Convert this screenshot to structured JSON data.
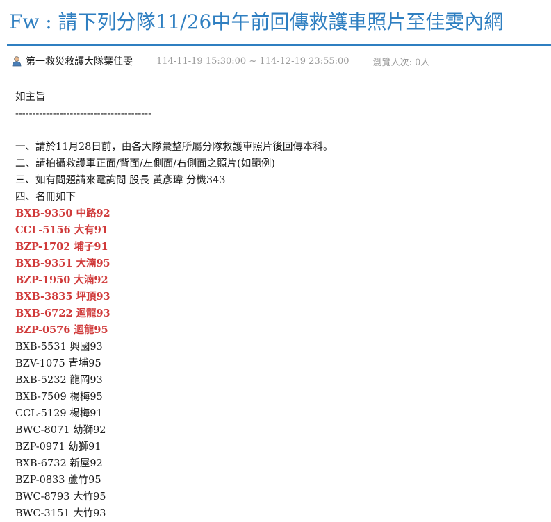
{
  "post": {
    "title": "Fw : 請下列分隊11/26中午前回傳救護車照片至佳雯內網",
    "author": "第一救災救護大隊葉佳雯",
    "period": "114-11-19 15:30:00 ~ 114-12-19 23:55:00",
    "views": "瀏覽人次: 0人"
  },
  "body": {
    "heading": "如主旨",
    "separator": "----------------------------------------",
    "items": [
      "一、請於11月28日前，由各大隊彙整所屬分隊救護車照片後回傳本科。",
      "二、請拍攝救護車正面/背面/左側面/右側面之照片(如範例)",
      "三、如有問題請來電詢問 股長 黃彥瑋 分機343",
      "四、名冊如下"
    ],
    "vehicles": [
      {
        "text": "BXB-9350 中路92",
        "highlight": true
      },
      {
        "text": "CCL-5156 大有91",
        "highlight": true
      },
      {
        "text": "BZP-1702 埔子91",
        "highlight": true
      },
      {
        "text": "BXB-9351 大湳95",
        "highlight": true
      },
      {
        "text": "BZP-1950 大湳92",
        "highlight": true
      },
      {
        "text": "BXB-3835 坪頂93",
        "highlight": true
      },
      {
        "text": "BXB-6722 迴龍93",
        "highlight": true
      },
      {
        "text": "BZP-0576 迴龍95",
        "highlight": true
      },
      {
        "text": "BXB-5531 興國93",
        "highlight": false
      },
      {
        "text": "BZV-1075 青埔95",
        "highlight": false
      },
      {
        "text": "BXB-5232 龍岡93",
        "highlight": false
      },
      {
        "text": "BXB-7509 楊梅95",
        "highlight": false
      },
      {
        "text": "CCL-5129 楊梅91",
        "highlight": false
      },
      {
        "text": "BWC-8071 幼獅92",
        "highlight": false
      },
      {
        "text": "BZP-0971 幼獅91",
        "highlight": false
      },
      {
        "text": "BXB-6732 新屋92",
        "highlight": false
      },
      {
        "text": "BZP-0833 蘆竹95",
        "highlight": false
      },
      {
        "text": "BWC-8793 大竹95",
        "highlight": false
      },
      {
        "text": "BWC-3151 大竹93",
        "highlight": false
      }
    ]
  },
  "colors": {
    "title": "#2f7fc1",
    "highlight": "#d03a3a",
    "meta": "#9a9a9a"
  },
  "icons": {
    "author": "user-icon"
  }
}
